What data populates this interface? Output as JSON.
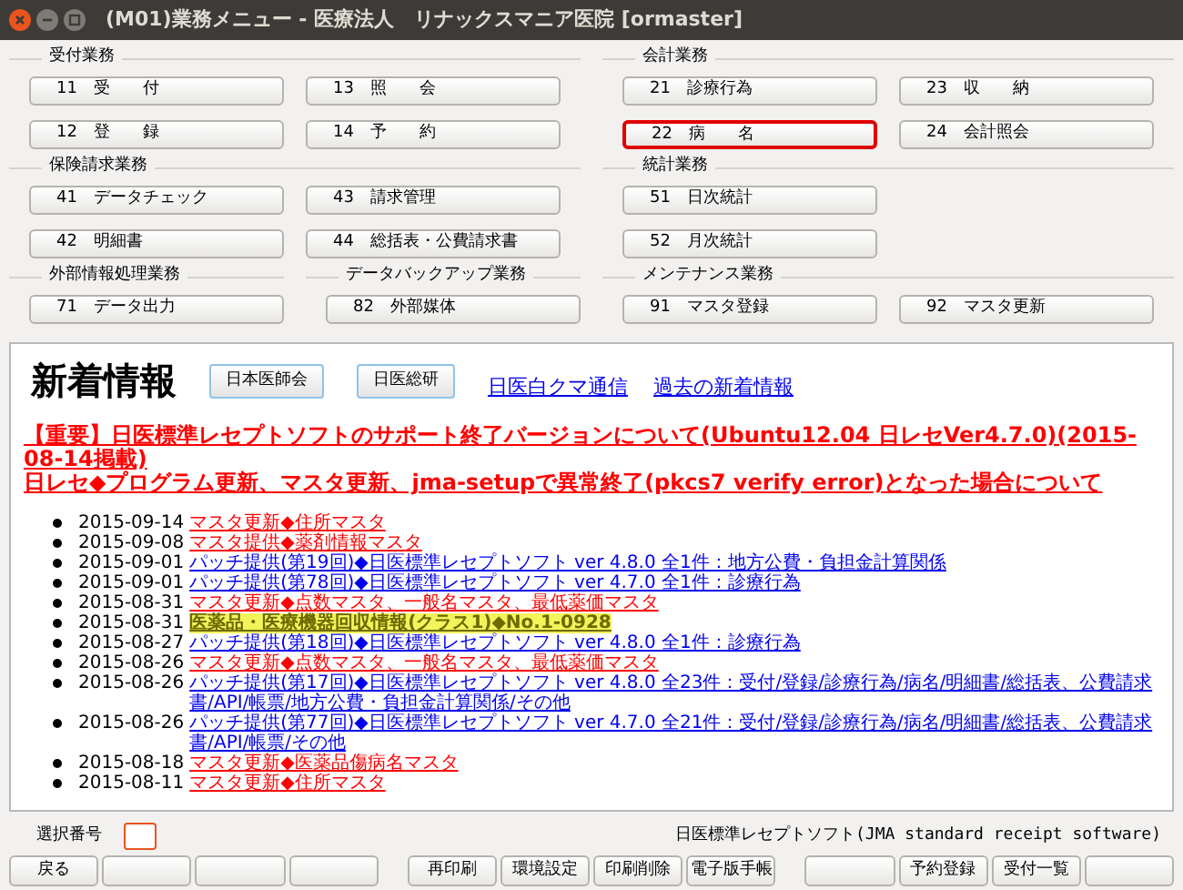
{
  "window": {
    "title": "(M01)業務メニュー - 医療法人　リナックスマニア医院  [ormaster]"
  },
  "menu_rows": [
    {
      "sections": [
        {
          "title": "受付業務",
          "buttons": [
            {
              "label": "11　受　　付",
              "selected": false
            },
            {
              "label": "13　照　　会",
              "selected": false
            },
            {
              "label": "12　登　　録",
              "selected": false
            },
            {
              "label": "14　予　　約",
              "selected": false
            }
          ]
        },
        {
          "title": "会計業務",
          "buttons": [
            {
              "label": "21　診療行為",
              "selected": false
            },
            {
              "label": "23　収　　納",
              "selected": false
            },
            {
              "label": "22　病　　名",
              "selected": true
            },
            {
              "label": "24　会計照会",
              "selected": false
            }
          ]
        }
      ]
    },
    {
      "sections": [
        {
          "title": "保険請求業務",
          "buttons": [
            {
              "label": "41　データチェック",
              "selected": false
            },
            {
              "label": "43　請求管理",
              "selected": false
            },
            {
              "label": "42　明細書",
              "selected": false
            },
            {
              "label": "44　総括表・公費請求書",
              "selected": false
            }
          ]
        },
        {
          "title": "統計業務",
          "buttons": [
            {
              "label": "51　日次統計",
              "selected": false
            },
            {
              "label": "52　月次統計",
              "selected": false
            }
          ]
        }
      ]
    },
    {
      "sections": [
        {
          "title": "外部情報処理業務",
          "buttons": [
            {
              "label": "71　データ出力",
              "selected": false
            }
          ]
        },
        {
          "title": "データバックアップ業務",
          "buttons": [
            {
              "label": "82　外部媒体",
              "selected": false
            }
          ]
        },
        {
          "title": "メンテナンス業務",
          "buttons": [
            {
              "label": "91　マスタ登録",
              "selected": false
            },
            {
              "label": "92　マスタ更新",
              "selected": false
            }
          ]
        }
      ]
    }
  ],
  "news": {
    "heading": "新着情報",
    "buttons": [
      "日本医師会",
      "日医総研"
    ],
    "links": [
      "日医白クマ通信",
      "過去の新着情報"
    ],
    "headlines": [
      "【重要】日医標準レセプトソフトのサポート終了バージョンについて(Ubuntu12.04 日レセVer4.7.0)(2015-08-14掲載)",
      "日レセ◆プログラム更新、マスタ更新、jma-setupで異常終了(pkcs7 verify error)となった場合について"
    ],
    "items": [
      {
        "date": "2015-09-14",
        "text": "マスタ更新◆住所マスタ",
        "kind": "master"
      },
      {
        "date": "2015-09-08",
        "text": "マスタ提供◆薬剤情報マスタ",
        "kind": "master"
      },
      {
        "date": "2015-09-01",
        "text": "パッチ提供(第19回)◆日医標準レセプトソフト ver 4.8.0 全1件：地方公費・負担金計算関係",
        "kind": "patch"
      },
      {
        "date": "2015-09-01",
        "text": "パッチ提供(第78回)◆日医標準レセプトソフト ver 4.7.0 全1件：診療行為",
        "kind": "patch"
      },
      {
        "date": "2015-08-31",
        "text": "マスタ更新◆点数マスタ、一般名マスタ、最低薬価マスタ",
        "kind": "master"
      },
      {
        "date": "2015-08-31",
        "text": "医薬品・医療機器回収情報(クラス1)◆No.1-0928",
        "kind": "recall"
      },
      {
        "date": "2015-08-27",
        "text": "パッチ提供(第18回)◆日医標準レセプトソフト ver 4.8.0 全1件：診療行為",
        "kind": "patch"
      },
      {
        "date": "2015-08-26",
        "text": "マスタ更新◆点数マスタ、一般名マスタ、最低薬価マスタ",
        "kind": "master"
      },
      {
        "date": "2015-08-26",
        "text": "パッチ提供(第17回)◆日医標準レセプトソフト ver 4.8.0 全23件：受付/登録/診療行為/病名/明細書/総括表、公費請求書/API/帳票/地方公費・負担金計算関係/その他",
        "kind": "patch"
      },
      {
        "date": "2015-08-26",
        "text": "パッチ提供(第77回)◆日医標準レセプトソフト ver 4.7.0 全21件：受付/登録/診療行為/病名/明細書/総括表、公費請求書/API/帳票/その他",
        "kind": "patch"
      },
      {
        "date": "2015-08-18",
        "text": "マスタ更新◆医薬品傷病名マスタ",
        "kind": "master"
      },
      {
        "date": "2015-08-11",
        "text": "マスタ更新◆住所マスタ",
        "kind": "master"
      }
    ]
  },
  "selection": {
    "label": "選択番号"
  },
  "product": "日医標準レセプトソフト(JMA standard receipt software)",
  "function_keys": [
    {
      "kind": "key",
      "label": "戻る"
    },
    {
      "kind": "blank"
    },
    {
      "kind": "blank"
    },
    {
      "kind": "blank"
    },
    {
      "kind": "key",
      "label": "再印刷"
    },
    {
      "kind": "key",
      "label": "環境設定"
    },
    {
      "kind": "key",
      "label": "印刷削除"
    },
    {
      "kind": "key",
      "label": "電子版手帳"
    },
    {
      "kind": "blank"
    },
    {
      "kind": "key",
      "label": "予約登録"
    },
    {
      "kind": "key",
      "label": "受付一覧"
    },
    {
      "kind": "blank"
    }
  ]
}
